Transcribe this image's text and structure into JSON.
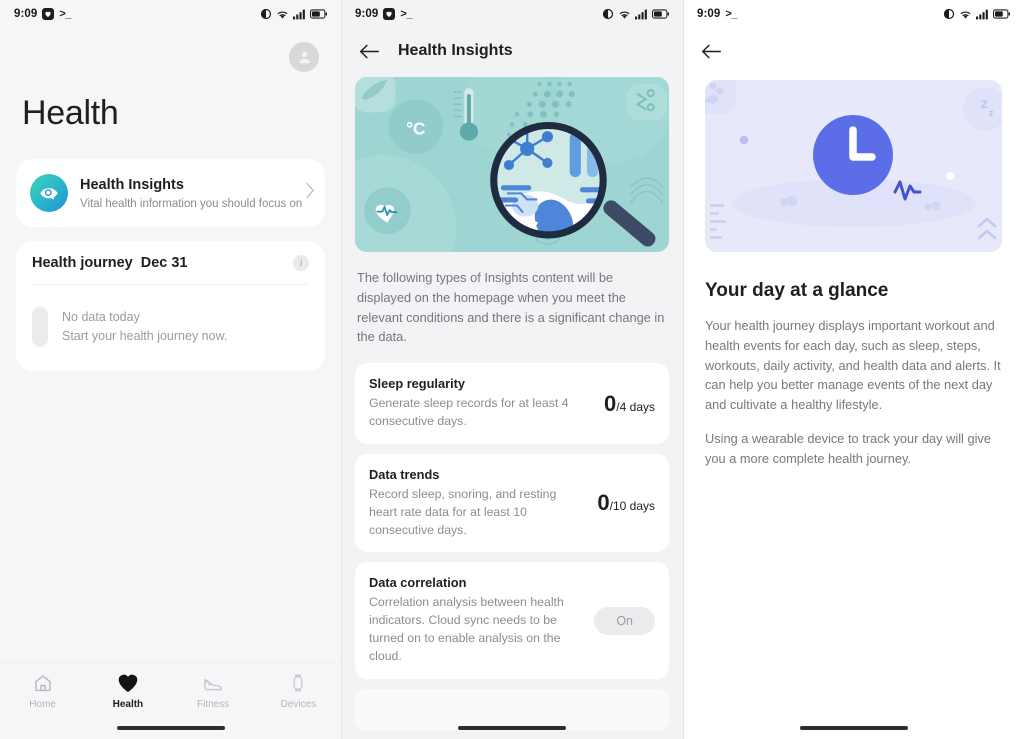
{
  "status_bar": {
    "time": "9:09",
    "app_badge_icon": "heart-badge-icon",
    "terminal_icon": ">_",
    "icons": [
      "dnd-icon",
      "wifi-icon",
      "signal-icon",
      "battery-icon"
    ],
    "battery_level": "43"
  },
  "panel_home": {
    "avatar_icon": "user-avatar-icon",
    "page_title": "Health",
    "insights_card": {
      "icon": "health-insights-magnifier-icon",
      "title": "Health Insights",
      "subtitle": "Vital health information you should focus on",
      "chevron_icon": "chevron-right-icon"
    },
    "journey_card": {
      "title": "Health journey",
      "date": "Dec 31",
      "info_icon": "info-icon",
      "empty_title": "No data today",
      "empty_sub": "Start your health journey now."
    },
    "bottom_nav": [
      {
        "label": "Home",
        "icon": "home-icon",
        "active": false
      },
      {
        "label": "Health",
        "icon": "heart-icon",
        "active": true
      },
      {
        "label": "Fitness",
        "icon": "shoe-icon",
        "active": false
      },
      {
        "label": "Devices",
        "icon": "watch-icon",
        "active": false
      }
    ]
  },
  "panel_insights": {
    "back_icon": "back-arrow-icon",
    "title": "Health Insights",
    "hero_icon": "health-data-magnifier-illustration",
    "description": "The following types of Insights content will be displayed on the homepage when you meet the relevant conditions and there is a significant change in the data.",
    "items": [
      {
        "title": "Sleep regularity",
        "desc": "Generate sleep records for at least 4 consecutive days.",
        "metric_value": "0",
        "metric_unit": "/4 days",
        "action": null
      },
      {
        "title": "Data trends",
        "desc": "Record sleep, snoring, and resting heart rate data for at least 10 consecutive days.",
        "metric_value": "0",
        "metric_unit": "/10 days",
        "action": null
      },
      {
        "title": "Data correlation",
        "desc": "Correlation analysis between health indicators. Cloud sync needs to be turned on to enable analysis on the cloud.",
        "metric_value": null,
        "metric_unit": null,
        "action": "On"
      }
    ]
  },
  "panel_glance": {
    "back_icon": "back-arrow-icon",
    "hero_icon": "clock-day-illustration",
    "title": "Your day at a glance",
    "paragraphs": [
      "Your health journey displays important workout and health events for each day, such as sleep, steps, workouts, daily activity, and health data and alerts. It can help you better manage events of the next day and cultivate a healthy lifestyle.",
      "Using a wearable device to track your day will give you a more complete health journey."
    ]
  },
  "colors": {
    "accent_teal": "#2fb9c9",
    "accent_blue": "#5b6ee8",
    "hero_teal_bg": "#9ed4d2",
    "hero_lavender_bg": "#e7e9fb",
    "text_primary": "#1d1f21",
    "text_secondary": "#8a8d91",
    "panel_bg": "#f5f6f7"
  }
}
